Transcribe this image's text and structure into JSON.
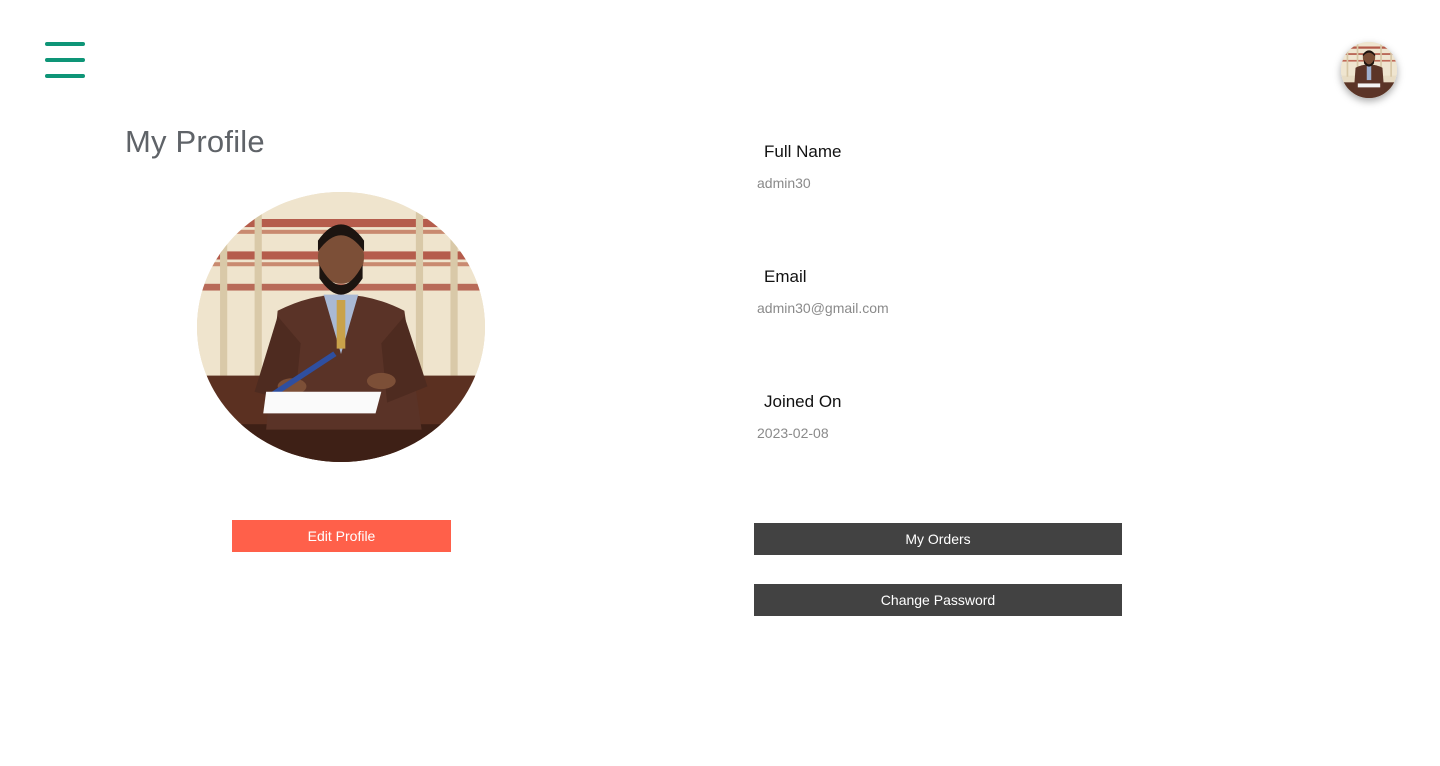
{
  "header": {
    "menu_icon": "hamburger-menu-icon",
    "menu_color": "#0e9577",
    "avatar_alt": "user-avatar"
  },
  "profile": {
    "title": "My Profile",
    "edit_button_label": "Edit Profile",
    "edit_button_color": "#ff604a"
  },
  "details": {
    "full_name_label": "Full Name",
    "full_name_value": "admin30",
    "email_label": "Email",
    "email_value": "admin30@gmail.com",
    "joined_label": "Joined On",
    "joined_value": "2023-02-08"
  },
  "actions": {
    "my_orders_label": "My Orders",
    "change_password_label": "Change Password",
    "button_color": "#424242"
  }
}
